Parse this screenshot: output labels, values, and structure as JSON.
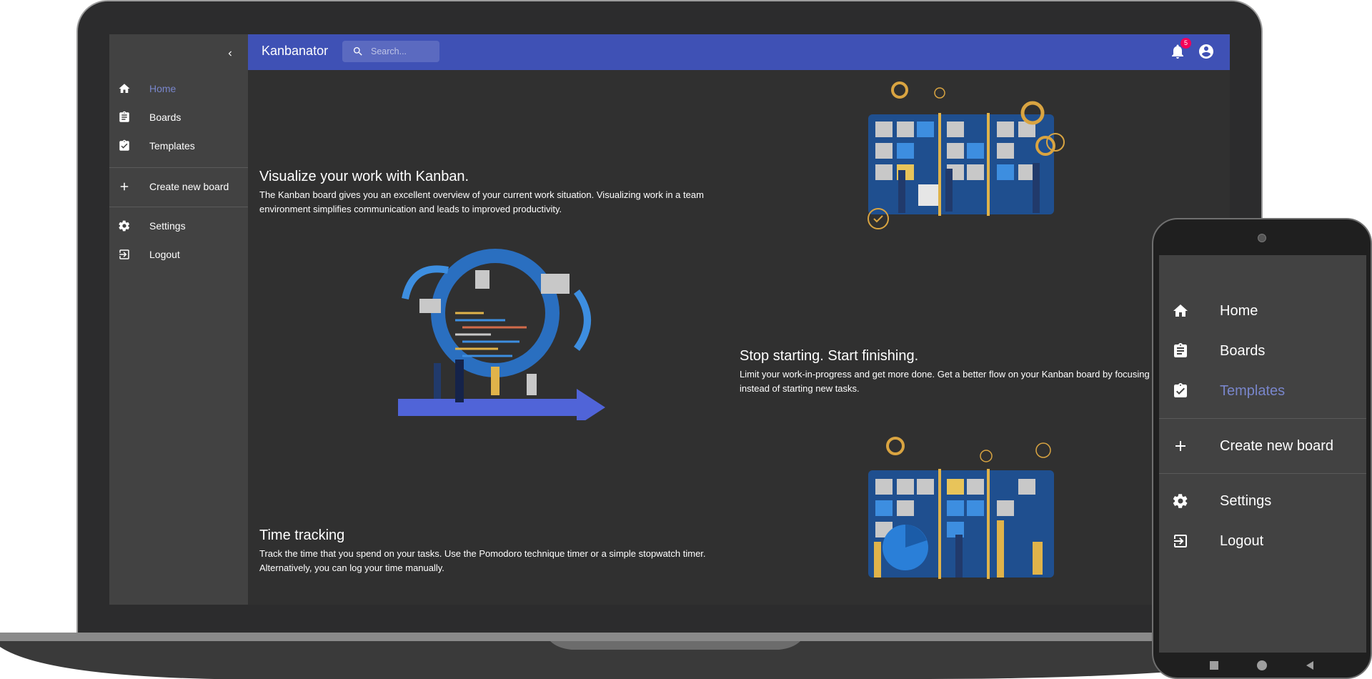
{
  "app": {
    "title": "Kanbanator"
  },
  "search": {
    "placeholder": "Search..."
  },
  "notifications": {
    "count": "5"
  },
  "sidebar": {
    "items": [
      {
        "label": "Home",
        "icon": "home-icon",
        "active": true
      },
      {
        "label": "Boards",
        "icon": "clipboard-icon"
      },
      {
        "label": "Templates",
        "icon": "clipboard-check-icon"
      },
      {
        "label": "Create new board",
        "icon": "plus-icon"
      },
      {
        "label": "Settings",
        "icon": "gear-icon"
      },
      {
        "label": "Logout",
        "icon": "logout-icon"
      }
    ]
  },
  "sections": [
    {
      "title": "Visualize your work with Kanban.",
      "text": "The Kanban board gives you an excellent overview of your current work situation. Visualizing work in a team environment simplifies communication and leads to improved productivity."
    },
    {
      "title": "Stop starting. Start finishing.",
      "text": "Limit your work-in-progress and get more done. Get a better flow on your Kanban board by focusing on completing tasks instead of starting new tasks."
    },
    {
      "title": "Time tracking",
      "text": "Track the time that you spend on your tasks. Use the Pomodoro technique timer or a simple stopwatch timer. Alternatively, you can log your time manually."
    }
  ],
  "phone": {
    "items": [
      {
        "label": "Home",
        "icon": "home-icon"
      },
      {
        "label": "Boards",
        "icon": "clipboard-icon"
      },
      {
        "label": "Templates",
        "icon": "clipboard-check-icon",
        "active": true
      },
      {
        "label": "Create new board",
        "icon": "plus-icon"
      },
      {
        "label": "Settings",
        "icon": "gear-icon"
      },
      {
        "label": "Logout",
        "icon": "logout-icon"
      }
    ]
  },
  "colors": {
    "appbar": "#3f51b5",
    "active": "#7986cb",
    "sidebar": "#424242",
    "content": "#303030",
    "badge": "#f50057"
  }
}
